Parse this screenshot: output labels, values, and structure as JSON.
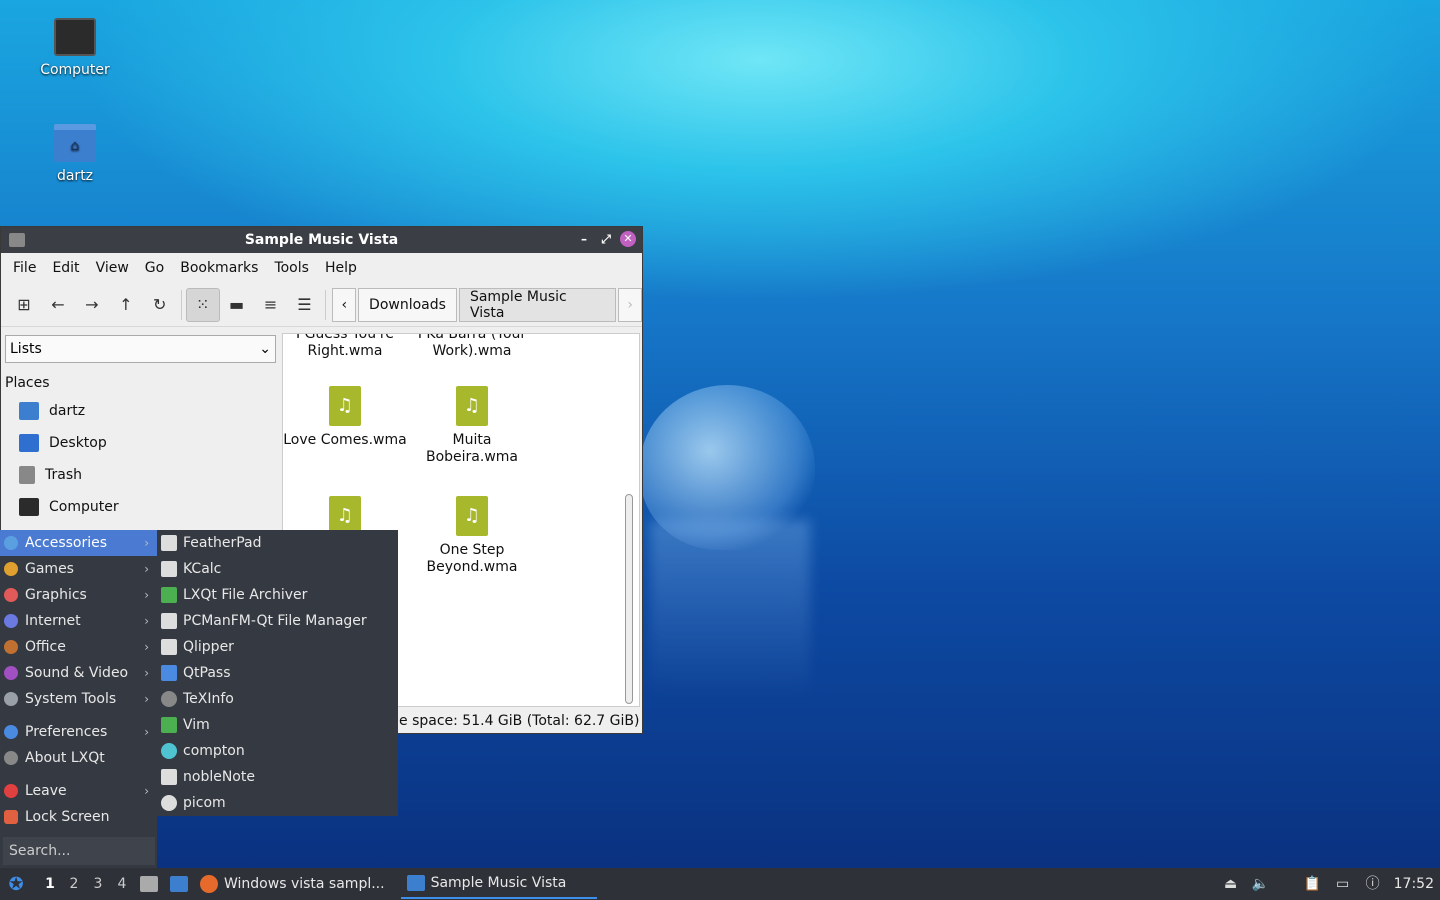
{
  "desktop": {
    "icons": [
      {
        "label": "Computer"
      },
      {
        "label": "dartz"
      }
    ]
  },
  "window": {
    "title": "Sample Music Vista",
    "menu": [
      "File",
      "Edit",
      "View",
      "Go",
      "Bookmarks",
      "Tools",
      "Help"
    ],
    "breadcrumb": [
      "Downloads",
      "Sample Music Vista"
    ],
    "side": {
      "view_select": "Lists",
      "places_title": "Places",
      "places": [
        "dartz",
        "Desktop",
        "Trash",
        "Computer"
      ]
    },
    "files": [
      {
        "name": "I Guess You're Right.wma"
      },
      {
        "name": "I Ka Barra (Your Work).wma"
      },
      {
        "name": "Love Comes.wma"
      },
      {
        "name": "Muita Bobeira.wma"
      },
      {
        "name": ""
      },
      {
        "name": "One Step Beyond.wma"
      }
    ],
    "status": "e space: 51.4 GiB (Total: 62.7 GiB)"
  },
  "appmenu": {
    "categories": [
      {
        "label": "Accessories",
        "color": "#5aa0e0"
      },
      {
        "label": "Games",
        "color": "#e0a030"
      },
      {
        "label": "Graphics",
        "color": "#e05a5a"
      },
      {
        "label": "Internet",
        "color": "#6a7ae0"
      },
      {
        "label": "Office",
        "color": "#c07030"
      },
      {
        "label": "Sound & Video",
        "color": "#a050c0"
      },
      {
        "label": "System Tools",
        "color": "#9aa0a8"
      }
    ],
    "extra": [
      {
        "label": "Preferences",
        "color": "#4a8ae0"
      },
      {
        "label": "About LXQt",
        "color": "#888888"
      }
    ],
    "session": [
      {
        "label": "Leave",
        "color": "#e04040"
      },
      {
        "label": "Lock Screen",
        "color": "#e06040"
      }
    ],
    "search_placeholder": "Search..."
  },
  "submenu": {
    "items": [
      {
        "label": "FeatherPad",
        "color": "#dddddd"
      },
      {
        "label": "KCalc",
        "color": "#dddddd"
      },
      {
        "label": "LXQt File Archiver",
        "color": "#4caf50"
      },
      {
        "label": "PCManFM-Qt File Manager",
        "color": "#dddddd"
      },
      {
        "label": "Qlipper",
        "color": "#dddddd"
      },
      {
        "label": "QtPass",
        "color": "#4a8ae0"
      },
      {
        "label": "TeXInfo",
        "color": "#888888"
      },
      {
        "label": "Vim",
        "color": "#4caf50"
      },
      {
        "label": "compton",
        "color": "#4fc3d0"
      },
      {
        "label": "nobleNote",
        "color": "#dddddd"
      },
      {
        "label": "picom",
        "color": "#dddddd"
      }
    ]
  },
  "taskbar": {
    "workspaces": [
      "1",
      "2",
      "3",
      "4"
    ],
    "tasks": [
      {
        "label": "Windows vista sampl..."
      },
      {
        "label": "Sample Music Vista"
      }
    ],
    "clock": "17:52"
  }
}
